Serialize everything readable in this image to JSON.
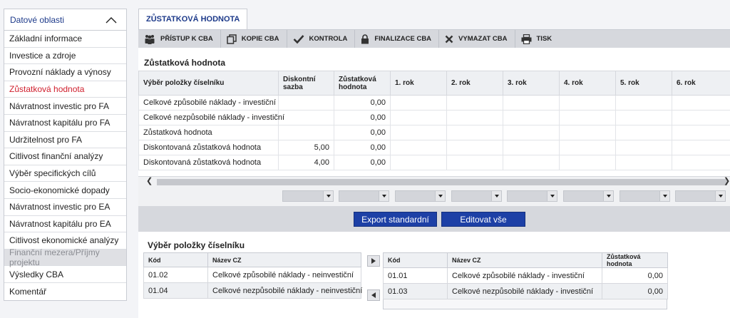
{
  "sidebar": {
    "title": "Datové oblasti",
    "items": [
      {
        "label": "Základní informace"
      },
      {
        "label": "Investice a zdroje"
      },
      {
        "label": "Provozní náklady a výnosy"
      },
      {
        "label": "Zůstatková hodnota"
      },
      {
        "label": "Návratnost investic pro FA"
      },
      {
        "label": "Návratnost kapitálu pro FA"
      },
      {
        "label": "Udržitelnost pro FA"
      },
      {
        "label": "Citlivost finanční analýzy"
      },
      {
        "label": "Výběr specifických cílů"
      },
      {
        "label": "Socio-ekonomické dopady"
      },
      {
        "label": "Návratnost investic pro EA"
      },
      {
        "label": "Návratnost kapitálu pro EA"
      },
      {
        "label": "Citlivost ekonomické analýzy"
      },
      {
        "label": "Finanční mezera/Příjmy projektu"
      },
      {
        "label": "Výsledky CBA"
      },
      {
        "label": "Komentář"
      }
    ]
  },
  "tab": {
    "label": "ZŮSTATKOVÁ HODNOTA"
  },
  "toolbar": {
    "access": "PŘÍSTUP K CBA",
    "copy": "KOPIE CBA",
    "check": "KONTROLA",
    "finalize": "FINALIZACE CBA",
    "delete": "VYMAZAT CBA",
    "print": "TISK"
  },
  "section": {
    "title": "Zůstatková hodnota"
  },
  "grid": {
    "headers": [
      "Výběr položky číselníku",
      "Diskontní sazba",
      "Zůstatková hodnota",
      "1. rok",
      "2. rok",
      "3. rok",
      "4. rok",
      "5. rok",
      "6. rok"
    ],
    "rows": [
      {
        "name": "Celkové způsobilé náklady - investiční",
        "rate": "",
        "value": "0,00"
      },
      {
        "name": "Celkové nezpůsobilé náklady - investiční",
        "rate": "",
        "value": "0,00"
      },
      {
        "name": "Zůstatková hodnota",
        "rate": "",
        "value": "0,00"
      },
      {
        "name": "Diskontovaná zůstatková hodnota",
        "rate": "5,00",
        "value": "0,00"
      },
      {
        "name": "Diskontovaná zůstatková hodnota",
        "rate": "4,00",
        "value": "0,00"
      }
    ]
  },
  "buttons": {
    "export": "Export standardní",
    "edit_all": "Editovat vše"
  },
  "selection": {
    "title": "Výběr položky číselníku",
    "left": {
      "headers": [
        "Kód",
        "Název CZ"
      ],
      "rows": [
        {
          "code": "01.02",
          "name": "Celkové způsobilé náklady - neinvestiční"
        },
        {
          "code": "01.04",
          "name": "Celkové nezpůsobilé náklady - neinvestiční"
        }
      ]
    },
    "right": {
      "headers": [
        "Kód",
        "Název CZ",
        "Zůstatková hodnota"
      ],
      "rows": [
        {
          "code": "01.01",
          "name": "Celkové způsobilé náklady - investiční",
          "value": "0,00"
        },
        {
          "code": "01.03",
          "name": "Celkové nezpůsobilé náklady - investiční",
          "value": "0,00"
        }
      ]
    }
  }
}
